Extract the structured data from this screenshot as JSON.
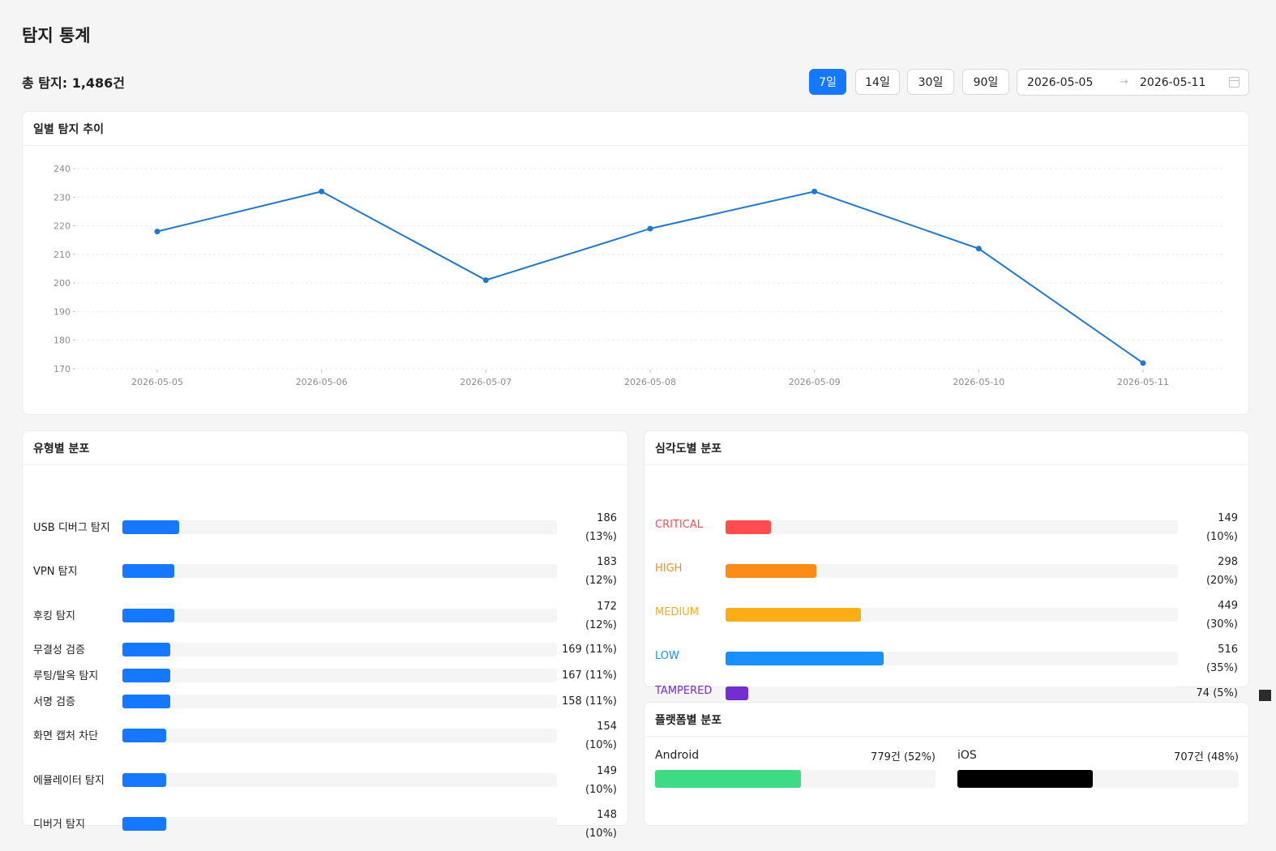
{
  "page": {
    "title": "탐지 통계",
    "total": "총 탐지: 1,486건"
  },
  "range_buttons": [
    {
      "label": "7일",
      "active": true
    },
    {
      "label": "14일",
      "active": false
    },
    {
      "label": "30일",
      "active": false
    },
    {
      "label": "90일",
      "active": false
    }
  ],
  "date_range": {
    "start": "2026-05-05",
    "arrow": "→",
    "end": "2026-05-11",
    "icon": "calendar-icon"
  },
  "trend": {
    "title": "일별 탐지 추이"
  },
  "chart_data": {
    "type": "line",
    "x": [
      "2026-05-05",
      "2026-05-06",
      "2026-05-07",
      "2026-05-08",
      "2026-05-09",
      "2026-05-10",
      "2026-05-11"
    ],
    "values": [
      218,
      232,
      201,
      219,
      232,
      212,
      172
    ],
    "ylim": [
      170,
      240
    ],
    "yticks": [
      170,
      180,
      190,
      200,
      210,
      220,
      230,
      240
    ],
    "grid": true,
    "color": "#1f78d1"
  },
  "type_dist": {
    "title": "유형별 분포",
    "items": [
      {
        "label": "USB 디버그 탐지",
        "count": "186",
        "pct": "(13%)",
        "value": 13
      },
      {
        "label": "VPN 탐지",
        "count": "183",
        "pct": "(12%)",
        "value": 12
      },
      {
        "label": "후킹 탐지",
        "count": "172",
        "pct": "(12%)",
        "value": 12
      },
      {
        "label": "무결성 검증",
        "count": "169",
        "pct": "(11%)",
        "value": 11
      },
      {
        "label": "루팅/탈옥 탐지",
        "count": "167",
        "pct": "(11%)",
        "value": 11
      },
      {
        "label": "서명 검증",
        "count": "158",
        "pct": "(11%)",
        "value": 11
      },
      {
        "label": "화면 캡처 차단",
        "count": "154",
        "pct": "(10%)",
        "value": 10
      },
      {
        "label": "에뮬레이터 탐지",
        "count": "149",
        "pct": "(10%)",
        "value": 10
      },
      {
        "label": "디버거 탐지",
        "count": "148",
        "pct": "(10%)",
        "value": 10
      }
    ],
    "color": "#1677ff"
  },
  "severity_dist": {
    "title": "심각도별 분포",
    "items": [
      {
        "label": "CRITICAL",
        "count": "149",
        "pct": "(10%)",
        "value": 10,
        "color": "#ff4d4f"
      },
      {
        "label": "HIGH",
        "count": "298",
        "pct": "(20%)",
        "value": 20,
        "color": "#fa8c16"
      },
      {
        "label": "MEDIUM",
        "count": "449",
        "pct": "(30%)",
        "value": 30,
        "color": "#faad14"
      },
      {
        "label": "LOW",
        "count": "516",
        "pct": "(35%)",
        "value": 35,
        "color": "#1890ff"
      },
      {
        "label": "TAMPERED",
        "count": "74",
        "pct": "(5%)",
        "value": 5,
        "color": "#722ed1"
      }
    ]
  },
  "platform_dist": {
    "title": "플랫폼별 분포",
    "items": [
      {
        "label": "Android",
        "value_text": "779건 (52%)",
        "value": 52,
        "color": "#3ddc84"
      },
      {
        "label": "iOS",
        "value_text": "707건 (48%)",
        "value": 48,
        "color": "#000000"
      }
    ]
  }
}
